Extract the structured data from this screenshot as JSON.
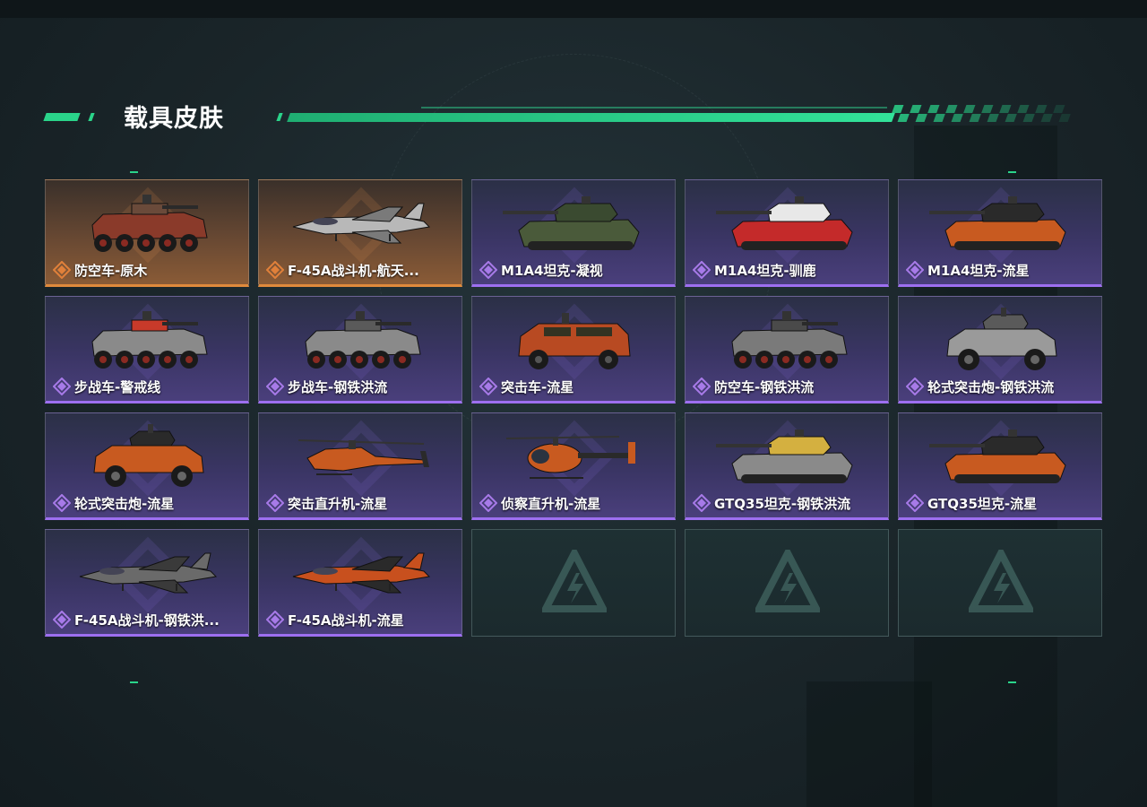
{
  "header": {
    "title": "载具皮肤"
  },
  "colors": {
    "accent_green": "#2ad48a",
    "purple_rarity": "#9d6ff0",
    "orange_rarity": "#e08a3c"
  },
  "skins": [
    {
      "name": "防空车-原木",
      "rarity": "orange",
      "vehicle": "wheeled-apc"
    },
    {
      "name": "F-45A战斗机-航天...",
      "rarity": "orange",
      "vehicle": "jet"
    },
    {
      "name": "M1A4坦克-凝视",
      "rarity": "purple",
      "vehicle": "tank"
    },
    {
      "name": "M1A4坦克-驯鹿",
      "rarity": "purple",
      "vehicle": "tank"
    },
    {
      "name": "M1A4坦克-流星",
      "rarity": "purple",
      "vehicle": "tank"
    },
    {
      "name": "步战车-警戒线",
      "rarity": "purple",
      "vehicle": "wheeled-apc"
    },
    {
      "name": "步战车-钢铁洪流",
      "rarity": "purple",
      "vehicle": "wheeled-apc"
    },
    {
      "name": "突击车-流星",
      "rarity": "purple",
      "vehicle": "truck"
    },
    {
      "name": "防空车-钢铁洪流",
      "rarity": "purple",
      "vehicle": "wheeled-apc"
    },
    {
      "name": "轮式突击炮-钢铁洪流",
      "rarity": "purple",
      "vehicle": "armored-car"
    },
    {
      "name": "轮式突击炮-流星",
      "rarity": "purple",
      "vehicle": "armored-car"
    },
    {
      "name": "突击直升机-流星",
      "rarity": "purple",
      "vehicle": "attack-heli"
    },
    {
      "name": "侦察直升机-流星",
      "rarity": "purple",
      "vehicle": "scout-heli"
    },
    {
      "name": "GTQ35坦克-钢铁洪流",
      "rarity": "purple",
      "vehicle": "tank"
    },
    {
      "name": "GTQ35坦克-流星",
      "rarity": "purple",
      "vehicle": "tank"
    },
    {
      "name": "F-45A战斗机-钢铁洪...",
      "rarity": "purple",
      "vehicle": "jet"
    },
    {
      "name": "F-45A战斗机-流星",
      "rarity": "purple",
      "vehicle": "jet"
    },
    {
      "name": "",
      "rarity": "empty",
      "vehicle": "logo"
    },
    {
      "name": "",
      "rarity": "empty",
      "vehicle": "logo"
    },
    {
      "name": "",
      "rarity": "empty",
      "vehicle": "logo"
    }
  ]
}
